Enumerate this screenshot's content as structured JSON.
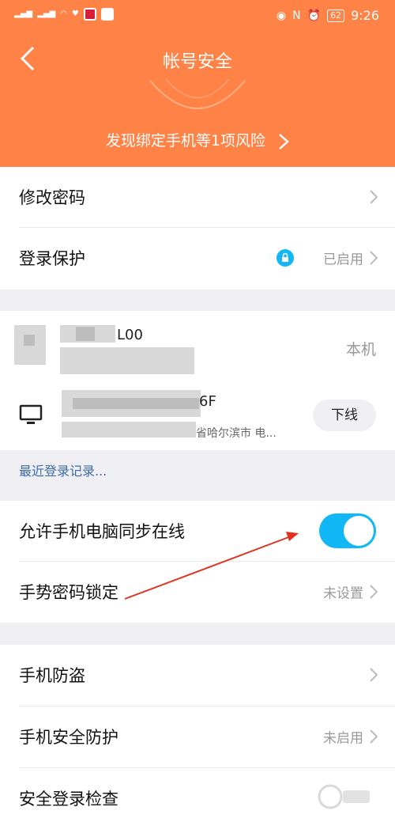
{
  "status_bar": {
    "battery": "62",
    "time": "9:26"
  },
  "header": {
    "title": "帐号安全",
    "risk_text": "发现绑定手机等1项风险"
  },
  "group1": {
    "change_password": "修改密码",
    "login_protection": "登录保护",
    "login_protection_status": "已启用"
  },
  "devices": {
    "device1_name_tail": "L00",
    "device1_status": "本机",
    "device2_name_tail": "6F",
    "device2_location": "省哈尔滨市 电...",
    "offline_button": "下线",
    "recent_login_link": "最近登录记录..."
  },
  "group2": {
    "sync_online": "允许手机电脑同步在线",
    "sync_online_enabled": true,
    "gesture_lock": "手势密码锁定",
    "gesture_lock_status": "未设置"
  },
  "group3": {
    "phone_antitheft": "手机防盗",
    "phone_security": "手机安全防护",
    "phone_security_status": "未启用",
    "safe_login_check": "安全登录检查"
  },
  "colors": {
    "header": "#ff8246",
    "accent": "#12b7f5",
    "annotation": "#e0321e"
  }
}
